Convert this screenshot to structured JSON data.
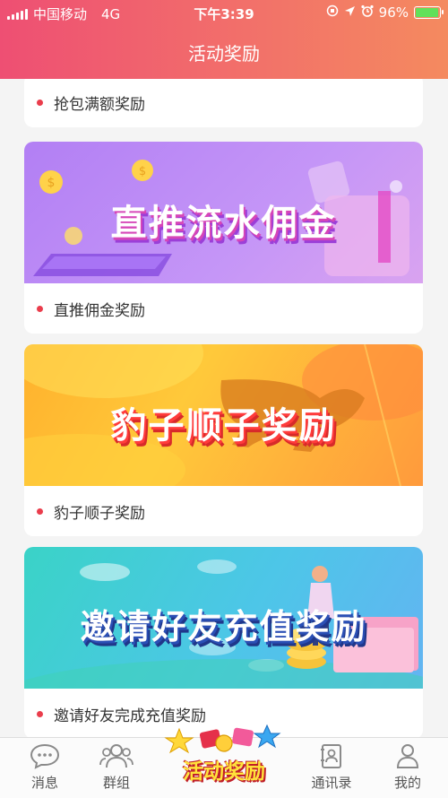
{
  "status_bar": {
    "carrier": "中国移动",
    "network": "4G",
    "time": "下午3:39",
    "battery": "96%",
    "battery_level": 0.96,
    "battery_color": "#62e05a"
  },
  "nav": {
    "title": "活动奖励"
  },
  "cards": [
    {
      "caption": "抢包满额奖励"
    },
    {
      "banner_text": "直推流水佣金",
      "caption": "直推佣金奖励"
    },
    {
      "banner_text": "豹子顺子奖励",
      "caption": "豹子顺子奖励"
    },
    {
      "banner_text": "邀请好友充值奖励",
      "caption": "邀请好友完成充值奖励"
    }
  ],
  "tabbar": {
    "messages": "消息",
    "groups": "群组",
    "center": "活动奖励",
    "contacts": "通讯录",
    "mine": "我的"
  },
  "colors": {
    "header_start": "#ee4f73",
    "header_end": "#f48a5f",
    "bullet": "#ea3d4c"
  }
}
